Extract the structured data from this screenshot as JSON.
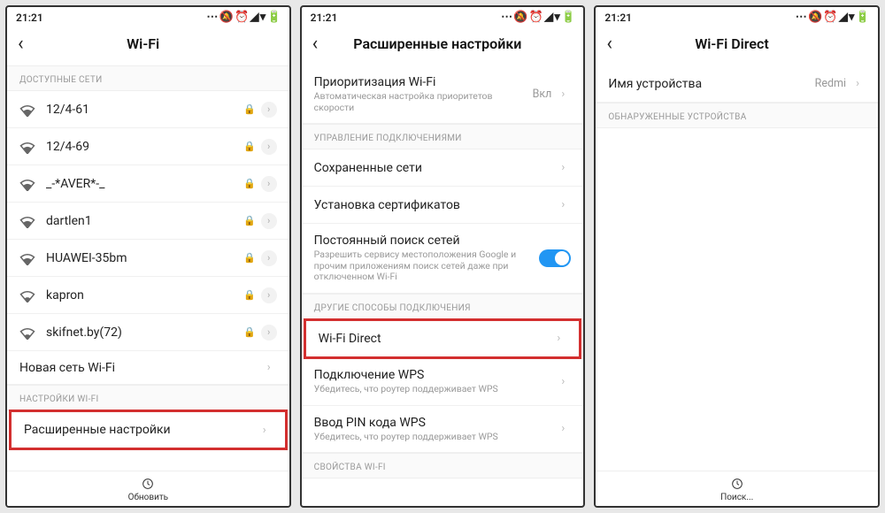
{
  "status": {
    "time": "21:21",
    "icons": "⋯  🔕 ⏰ ◢ ▾ 🔋"
  },
  "screen1": {
    "title": "Wi-Fi",
    "section_available": "ДОСТУПНЫЕ СЕТИ",
    "networks": [
      {
        "name": "12/4-61",
        "locked": true
      },
      {
        "name": "12/4-69",
        "locked": true
      },
      {
        "name": "_-*AVER*-_",
        "locked": true
      },
      {
        "name": "dartlen1",
        "locked": true
      },
      {
        "name": "HUAWEI-35bm",
        "locked": true
      },
      {
        "name": "kapron",
        "locked": true
      },
      {
        "name": "skifnet.by(72)",
        "locked": true
      }
    ],
    "new_network": "Новая сеть Wi-Fi",
    "section_settings": "НАСТРОЙКИ WI-FI",
    "advanced": "Расширенные настройки",
    "footer_refresh": "Обновить"
  },
  "screen2": {
    "title": "Расширенные настройки",
    "priority": {
      "label": "Приоритизация Wi-Fi",
      "sub": "Автоматическая настройка приоритетов скорости",
      "value": "Вкл"
    },
    "section_manage": "УПРАВЛЕНИЕ ПОДКЛЮЧЕНИЯМИ",
    "saved_networks": "Сохраненные сети",
    "install_certs": "Установка сертификатов",
    "scan": {
      "label": "Постоянный поиск сетей",
      "sub": "Разрешить сервису местоположения Google и прочим приложениям поиск сетей даже при отключенном Wi-Fi"
    },
    "section_other": "ДРУГИЕ СПОСОБЫ ПОДКЛЮЧЕНИЯ",
    "wifi_direct": "Wi-Fi Direct",
    "wps": {
      "label": "Подключение WPS",
      "sub": "Убедитесь, что роутер поддерживает WPS"
    },
    "wps_pin": {
      "label": "Ввод PIN кода WPS",
      "sub": "Убедитесь, что роутер поддерживает WPS"
    },
    "section_props": "СВОЙСТВА WI-FI"
  },
  "screen3": {
    "title": "Wi-Fi Direct",
    "device_name_label": "Имя устройства",
    "device_name_value": "Redmi",
    "section_discovered": "ОБНАРУЖЕННЫЕ УСТРОЙСТВА",
    "footer_search": "Поиск..."
  }
}
